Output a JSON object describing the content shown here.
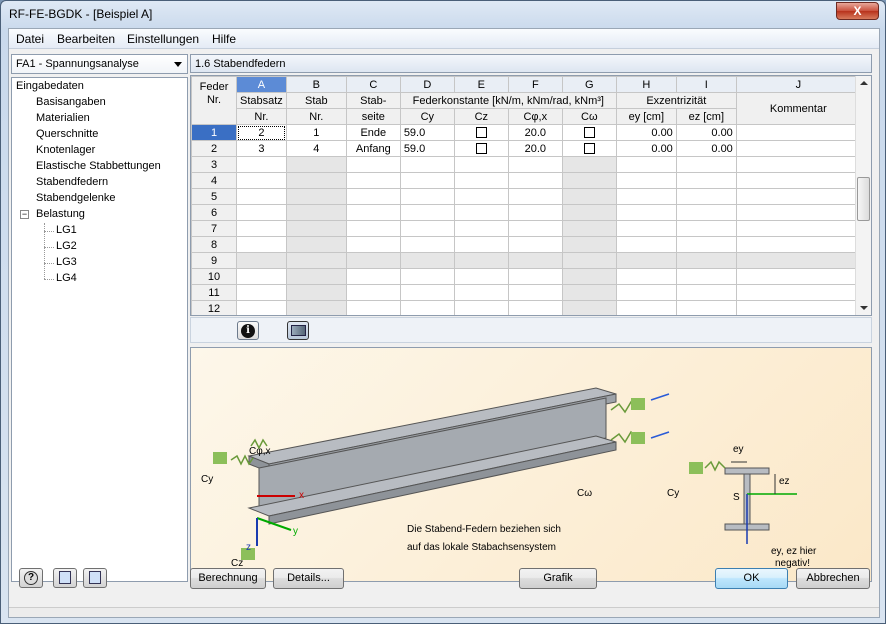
{
  "window": {
    "title": "RF-FE-BGDK - [Beispiel A]",
    "close": "X"
  },
  "menu": [
    "Datei",
    "Bearbeiten",
    "Einstellungen",
    "Hilfe"
  ],
  "combo": {
    "value": "FA1 - Spannungsanalyse"
  },
  "tree": {
    "root": "Eingabedaten",
    "items": [
      "Basisangaben",
      "Materialien",
      "Querschnitte",
      "Knotenlager",
      "Elastische Stabbettungen",
      "Stabendfedern",
      "Stabendgelenke",
      "Belastung"
    ],
    "lg": [
      "LG1",
      "LG2",
      "LG3",
      "LG4"
    ],
    "toggle": "−"
  },
  "panel_title": "1.6 Stabendfedern",
  "grid": {
    "col_letters": [
      "A",
      "B",
      "C",
      "D",
      "E",
      "F",
      "G",
      "H",
      "I",
      "J"
    ],
    "rowhdr": [
      "Feder",
      "Nr."
    ],
    "hdr_a": [
      "Stabsatz",
      "Nr."
    ],
    "hdr_b": [
      "Stab",
      "Nr."
    ],
    "hdr_c": [
      "Stab-",
      "seite"
    ],
    "hdr_fed": "Federkonstante [kN/m, kNm/rad, kNm³]",
    "hdr_cy": "Cy",
    "hdr_cz": "Cz",
    "hdr_cphi": "Cφ,x",
    "hdr_cw": "Cω",
    "hdr_exz": "Exzentrizität",
    "hdr_ey": "ey [cm]",
    "hdr_ez": "ez [cm]",
    "hdr_j": "Kommentar",
    "rows": [
      {
        "nr": "1",
        "a": "2",
        "b": "1",
        "c": "Ende",
        "d": "59.0",
        "f": "20.0",
        "h": "0.00",
        "i": "0.00"
      },
      {
        "nr": "2",
        "a": "3",
        "b": "4",
        "c": "Anfang",
        "d": "59.0",
        "f": "20.0",
        "h": "0.00",
        "i": "0.00"
      },
      {
        "nr": "3"
      },
      {
        "nr": "4"
      },
      {
        "nr": "5"
      },
      {
        "nr": "6"
      },
      {
        "nr": "7"
      },
      {
        "nr": "8"
      },
      {
        "nr": "9"
      },
      {
        "nr": "10"
      },
      {
        "nr": "11"
      },
      {
        "nr": "12"
      }
    ]
  },
  "figure": {
    "cphi": "Cφ,x",
    "cy": "Cy",
    "cz": "Cz",
    "cw": "Cω",
    "x": "x",
    "y": "y",
    "z": "z",
    "text1": "Die Stabend-Federn beziehen sich",
    "text2": "auf das lokale Stabachsensystem",
    "ey": "ey",
    "ez": "ez",
    "s": "S",
    "cy2": "Cy",
    "note1": "ey, ez hier",
    "note2": "negativ!"
  },
  "buttons": {
    "berechnung": "Berechnung",
    "details": "Details...",
    "grafik": "Grafik",
    "ok": "OK",
    "abbrechen": "Abbrechen"
  }
}
